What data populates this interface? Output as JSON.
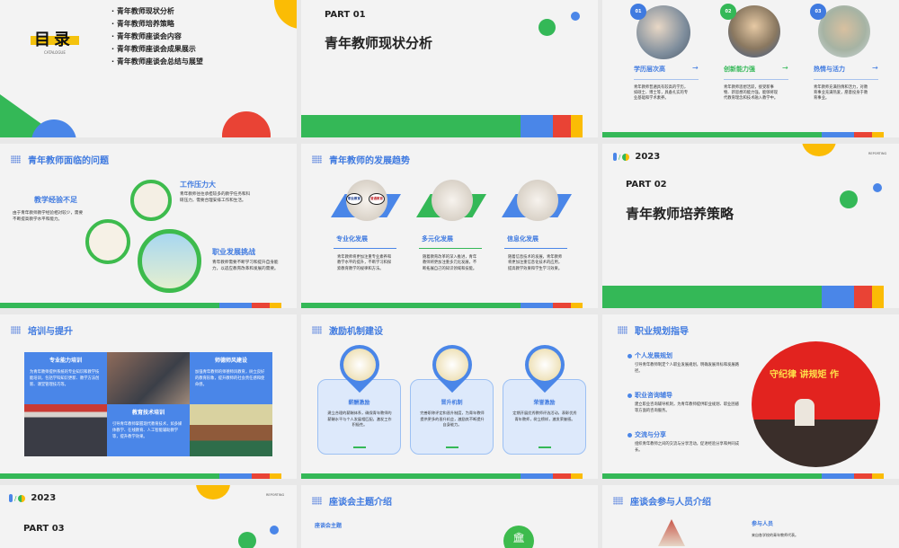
{
  "catalogue": {
    "title": "目录",
    "subtitle": "CATALOGUE",
    "items": [
      "青年教师现状分析",
      "青年教师培养策略",
      "青年教师座谈会内容",
      "青年教师座谈会成果展示",
      "青年教师座谈会总结与展望"
    ]
  },
  "part01": {
    "part": "PART 01",
    "title": "青年教师现状分析"
  },
  "status": {
    "items": [
      {
        "num": "01",
        "title": "学历层次高",
        "text": "青年教师普遍具有较高的学历，如硕士、博士等，具备扎实的专业基础和学术素养。",
        "color": "#3f7ae0"
      },
      {
        "num": "02",
        "title": "创新能力强",
        "text": "青年教师思想活跃，接受新事物、新思想的能力强，能够将现代教育理念和技术融入教学中。",
        "color": "#34b857"
      },
      {
        "num": "03",
        "title": "热情与活力",
        "text": "青年教师充满热情和活力，对教育事业充满热爱，愿意投身于教育事业。",
        "color": "#3f7ae0"
      }
    ],
    "arrow": "→"
  },
  "problems": {
    "title": "青年教师面临的问题",
    "items": [
      {
        "title": "教学经验不足",
        "text": "由于青年教师教学经验相对较少，需要不断提高教学水平和能力。"
      },
      {
        "title": "工作压力大",
        "text": "青年教师往往承担较多的教学任务和科研压力，需要合理安排工作和生活。"
      },
      {
        "title": "职业发展挑战",
        "text": "青年教师需要不断学习和提升自身能力，以适应教育改革和发展的需要。"
      }
    ]
  },
  "trends": {
    "title": "青年教师的发展趋势",
    "items": [
      {
        "title": "专业化发展",
        "text": "青年教师将更加注重专业素养和教学水平的提升，不断学习和探索教育教学的规律和方法。"
      },
      {
        "title": "多元化发展",
        "text": "随着教育改革的深入推进，青年教师将更加注重多元化发展，不断拓展自己的知识领域和技能。"
      },
      {
        "title": "信息化发展",
        "text": "随着信息技术的发展，青年教师将更加注重信息化技术的应用，提高教学效果和学生学习效果。"
      }
    ],
    "signs": [
      "职业教育",
      "普通教育"
    ]
  },
  "part02": {
    "year": "2023",
    "reporting": "REPORTING",
    "part": "PART 02",
    "title": "青年教师培养策略"
  },
  "training": {
    "title": "培训与提升",
    "items": [
      {
        "title": "专业能力培训",
        "text": "为青年教师提供系统的专业知识和教学技能培训，包括学科知识更新、教学方法创新、课堂管理技巧等。"
      },
      {
        "title": "师德师风建设",
        "text": "加强青年教师的师德师风教育，树立良好的教育形象，提升教师的社会责任感和使命感。"
      },
      {
        "title": "教育技术培训",
        "text": "引导青年教师掌握现代教育技术，如多媒体教学、在线教育、人工智能辅助教学等，提升教学效果。"
      }
    ]
  },
  "incentive": {
    "title": "激励机制建设",
    "items": [
      {
        "title": "薪酬激励",
        "text": "建立合理的薪酬体系，确保青年教师的薪酬水平与个人发展相匹配，激发工作积极性。"
      },
      {
        "title": "晋升机制",
        "text": "完善职称评定和晋升制度，为青年教师提供更多的晋升机会，激励其不断提升自身能力。"
      },
      {
        "title": "荣誉激励",
        "text": "定期开展优秀教师评选活动，表彰优秀青年教师，树立榜样，激发荣誉感。"
      }
    ]
  },
  "career": {
    "title": "职业规划指导",
    "banner": "守纪律 讲规矩 作",
    "items": [
      {
        "title": "个人发展规划",
        "text": "引导青年教师制定个人职业发展规划，明确发展目标和发展路径。"
      },
      {
        "title": "职业咨询辅导",
        "text": "建立职业咨询辅导机制，为青年教师提供职业规划、职业困惑等方面的咨询服务。"
      },
      {
        "title": "交流与分享",
        "text": "组织青年教师之间的交流与分享活动，促进经验分享和共同成长。"
      }
    ]
  },
  "part03": {
    "year": "2023",
    "reporting": "REPORTING",
    "part": "PART 03"
  },
  "theme": {
    "title": "座谈会主题介绍",
    "sub": "座谈会主题"
  },
  "people": {
    "title": "座谈会参与人员介绍",
    "sub": "参与人员",
    "text": "来自各学校的青年教师代表。"
  }
}
